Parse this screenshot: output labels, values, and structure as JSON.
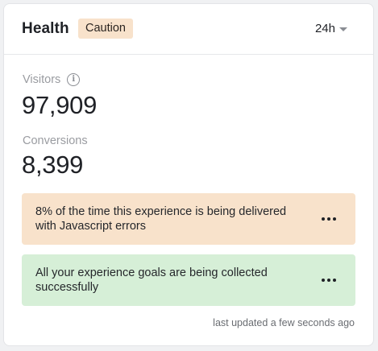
{
  "header": {
    "title": "Health",
    "status_badge": "Caution",
    "range": "24h"
  },
  "metrics": [
    {
      "label": "Visitors",
      "value": "97,909",
      "info_icon": "info-icon"
    },
    {
      "label": "Conversions",
      "value": "8,399"
    }
  ],
  "alerts": [
    {
      "type": "warning",
      "text": "8% of the time this experience is being delivered with Javascript errors",
      "color": "#f8e2cb",
      "menu_icon": "more-horizontal-icon"
    },
    {
      "type": "success",
      "text": "All your experience goals are being collected successfully",
      "color": "#d6efd7",
      "menu_icon": "more-horizontal-icon"
    }
  ],
  "footer": {
    "updated": "last updated a few seconds ago"
  },
  "colors": {
    "badge_caution": "#f8e2cb",
    "success": "#d6efd7"
  }
}
